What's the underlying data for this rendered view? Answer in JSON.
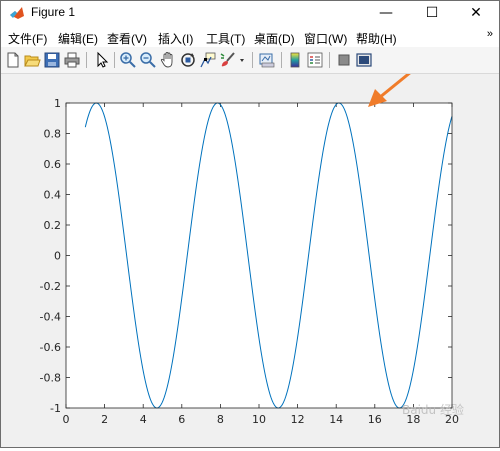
{
  "window": {
    "title": "Figure 1",
    "minimize_glyph": "—",
    "maximize_glyph": "☐",
    "close_glyph": "✕"
  },
  "menubar": {
    "items": [
      "文件(F)",
      "编辑(E)",
      "查看(V)",
      "插入(I)",
      "工具(T)",
      "桌面(D)",
      "窗口(W)",
      "帮助(H)"
    ],
    "overflow_glyph": "»"
  },
  "toolbar": {
    "icons": [
      "new-figure-icon",
      "open-file-icon",
      "save-icon",
      "print-icon",
      "pointer-icon",
      "zoom-in-icon",
      "zoom-out-icon",
      "pan-icon",
      "rotate-3d-icon",
      "data-cursor-icon",
      "brush-icon",
      "link-plot-icon",
      "colorbar-icon",
      "legend-icon",
      "hide-plot-tools-icon",
      "show-plot-tools-icon"
    ]
  },
  "annotation": {
    "arrow_color": "#f07c2a"
  },
  "watermark": "Baidu 经验",
  "chart_data": {
    "type": "line",
    "title": "",
    "xlabel": "",
    "ylabel": "",
    "xlim": [
      0,
      20
    ],
    "ylim": [
      -1,
      1
    ],
    "xticks": [
      "0",
      "2",
      "4",
      "6",
      "8",
      "10",
      "12",
      "14",
      "16",
      "18",
      "20"
    ],
    "yticks": [
      "-1",
      "-0.8",
      "-0.6",
      "-0.4",
      "-0.2",
      "0",
      "0.2",
      "0.4",
      "0.6",
      "0.8",
      "1"
    ],
    "grid": false,
    "series": [
      {
        "function": "sin(x)",
        "x_start": 1,
        "x_end": 20,
        "color": "#0072bd"
      }
    ]
  }
}
